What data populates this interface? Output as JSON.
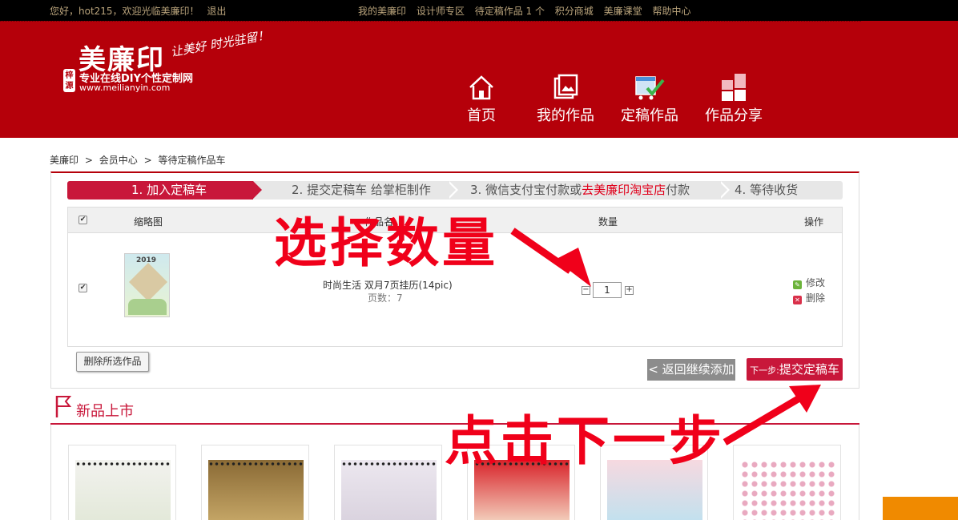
{
  "topbar": {
    "greeting": "您好，hot215，欢迎光临美廉印！",
    "logout": "退出",
    "links": [
      "我的美廉印",
      "设计师专区",
      "待定稿作品 1 个",
      "积分商城",
      "美廉课堂",
      "帮助中心"
    ]
  },
  "header": {
    "logo_main": "美廉印",
    "logo_slogan": "让美好 时光驻留！",
    "logo_badge": "梓源",
    "logo_sub": "专业在线DIY个性定制网",
    "logo_url": "www.meilianyin.com",
    "nav": [
      "首页",
      "我的作品",
      "定稿作品",
      "作品分享"
    ]
  },
  "breadcrumb": [
    "美廉印",
    ">",
    "会员中心",
    ">",
    "等待定稿作品车"
  ],
  "steps": {
    "s1": "1. 加入定稿车",
    "s2": "2. 提交定稿车 给掌柜制作",
    "s3a": "3. 微信支付宝付款或",
    "s3b": "去美廉印淘宝店",
    "s3c": "付款",
    "s4": "4. 等待收货"
  },
  "table": {
    "headers": {
      "thumb": "缩略图",
      "name": "作品名",
      "qty": "数量",
      "ops": "操作"
    },
    "row": {
      "thumb_text": "2019",
      "name": "时尚生活 双月7页挂历(14pic)",
      "pages": "页数：7",
      "qty": "1",
      "edit": "修改",
      "delete": "删除"
    }
  },
  "buttons": {
    "delete_selected": "删除所选作品",
    "back": "< 返回继续添加",
    "next_small": "下一步:",
    "next_big": "提交定稿车"
  },
  "new_section": {
    "title": "新品上市"
  },
  "annotations": {
    "select_qty": "选择数量",
    "click_next": "点击下一步"
  },
  "colors": {
    "brand_red": "#b5000a",
    "accent_red": "#c8173a",
    "annotation_red": "#f0001a",
    "topbar_text": "#b9a37b"
  }
}
